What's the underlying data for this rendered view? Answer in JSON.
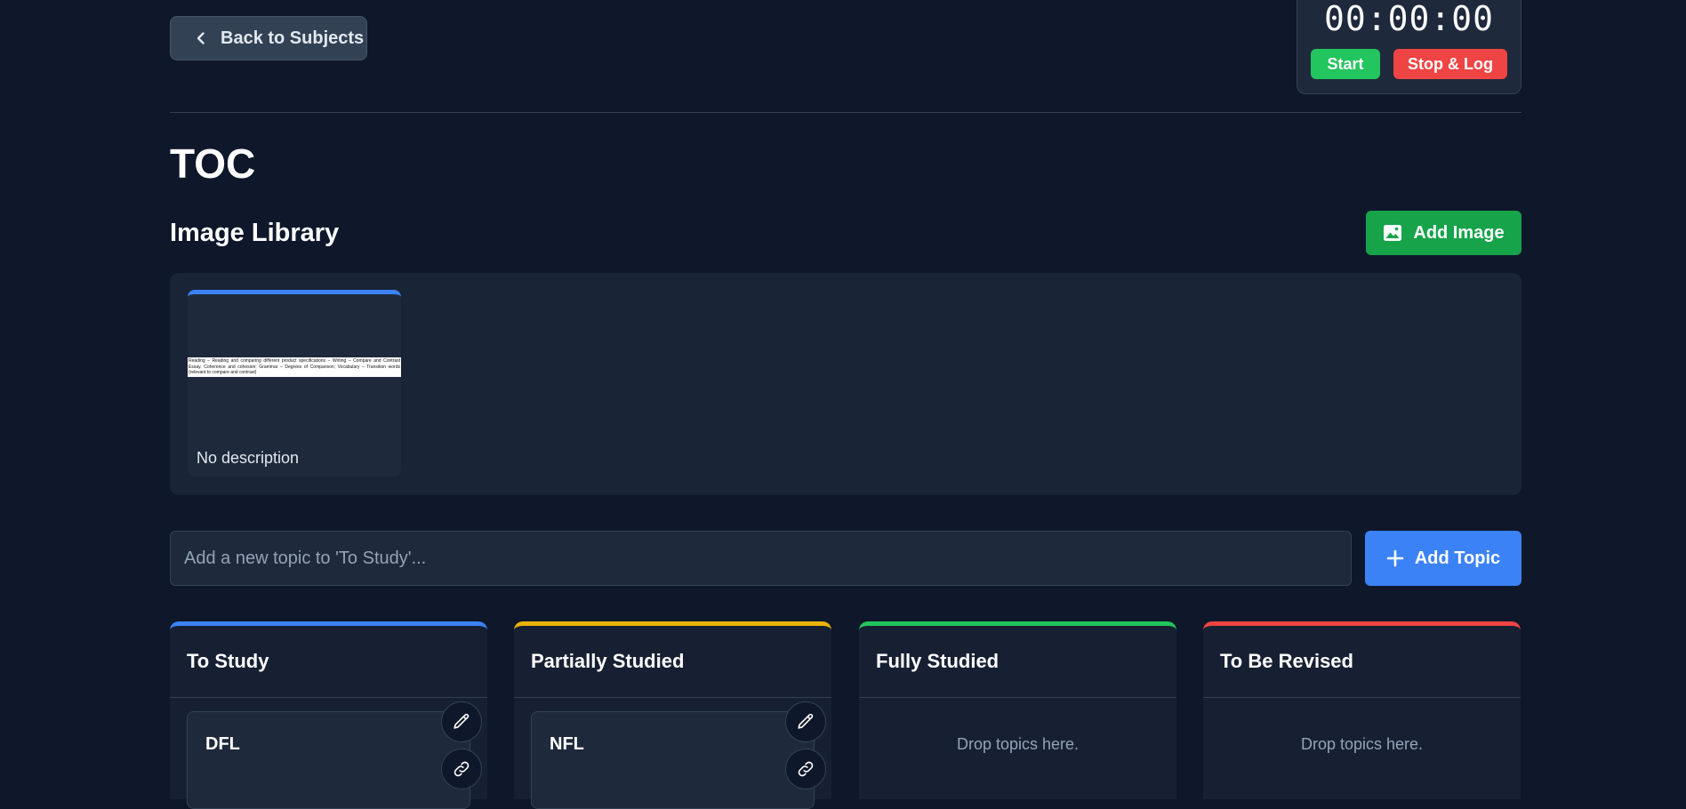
{
  "nav": {
    "back_label": "Back to Subjects"
  },
  "timer": {
    "display": "00:00:00",
    "start_label": "Start",
    "stop_label": "Stop & Log"
  },
  "page": {
    "title": "TOC"
  },
  "image_library": {
    "title": "Image Library",
    "add_label": "Add Image",
    "images": [
      {
        "thumb_text": "Reading – Reading and comparing different product specifications – Writing – Compare and Contrast Essay. Coherence and cohesion; Grammar – Degrees of Comparison; Vocabulary – Transition words (relevant to compare and contrast)",
        "description": "No description"
      }
    ]
  },
  "topic_form": {
    "placeholder": "Add a new topic to 'To Study'...",
    "value": "",
    "add_label": "Add Topic"
  },
  "columns": [
    {
      "title": "To Study",
      "color": "#3b82f6",
      "topics": [
        "DFL"
      ],
      "empty_text": ""
    },
    {
      "title": "Partially Studied",
      "color": "#eab308",
      "topics": [
        "NFL"
      ],
      "empty_text": ""
    },
    {
      "title": "Fully Studied",
      "color": "#22c55e",
      "topics": [],
      "empty_text": "Drop topics here."
    },
    {
      "title": "To Be Revised",
      "color": "#ef4444",
      "topics": [],
      "empty_text": "Drop topics here."
    }
  ],
  "icons": {
    "back": "chevron-left-icon",
    "add_image": "image-icon",
    "add_topic": "plus-icon",
    "edit": "pencil-icon",
    "link": "link-icon"
  }
}
